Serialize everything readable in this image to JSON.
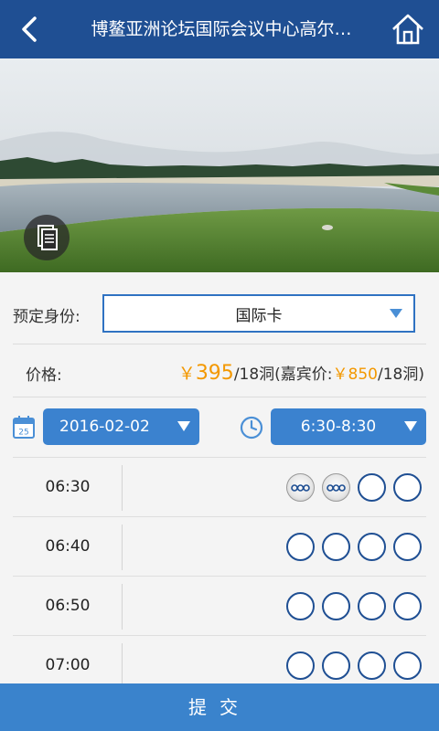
{
  "header": {
    "title": "博鳌亚洲论坛国际会议中心高尔…"
  },
  "form": {
    "identity_label": "预定身份:",
    "identity_value": "国际卡",
    "price_label": "价格:",
    "price": {
      "currency": "￥",
      "value": "395",
      "unit": "/18洞(嘉宾价:",
      "guest_currency": "￥",
      "guest_value": "850",
      "guest_unit": "/18洞)"
    },
    "date_value": "2016-02-02",
    "calendar_day": "25",
    "time_range": "6:30-8:30"
  },
  "tee_times": [
    {
      "time": "06:30",
      "slots": [
        "booked",
        "booked",
        "open",
        "open"
      ]
    },
    {
      "time": "06:40",
      "slots": [
        "open",
        "open",
        "open",
        "open"
      ]
    },
    {
      "time": "06:50",
      "slots": [
        "open",
        "open",
        "open",
        "open"
      ]
    },
    {
      "time": "07:00",
      "slots": [
        "open",
        "open",
        "open",
        "open"
      ]
    }
  ],
  "submit_label": "提交",
  "colors": {
    "header": "#1f4f93",
    "accent": "#3b82cf",
    "price": "#f39800",
    "submit": "#3a83cc"
  }
}
